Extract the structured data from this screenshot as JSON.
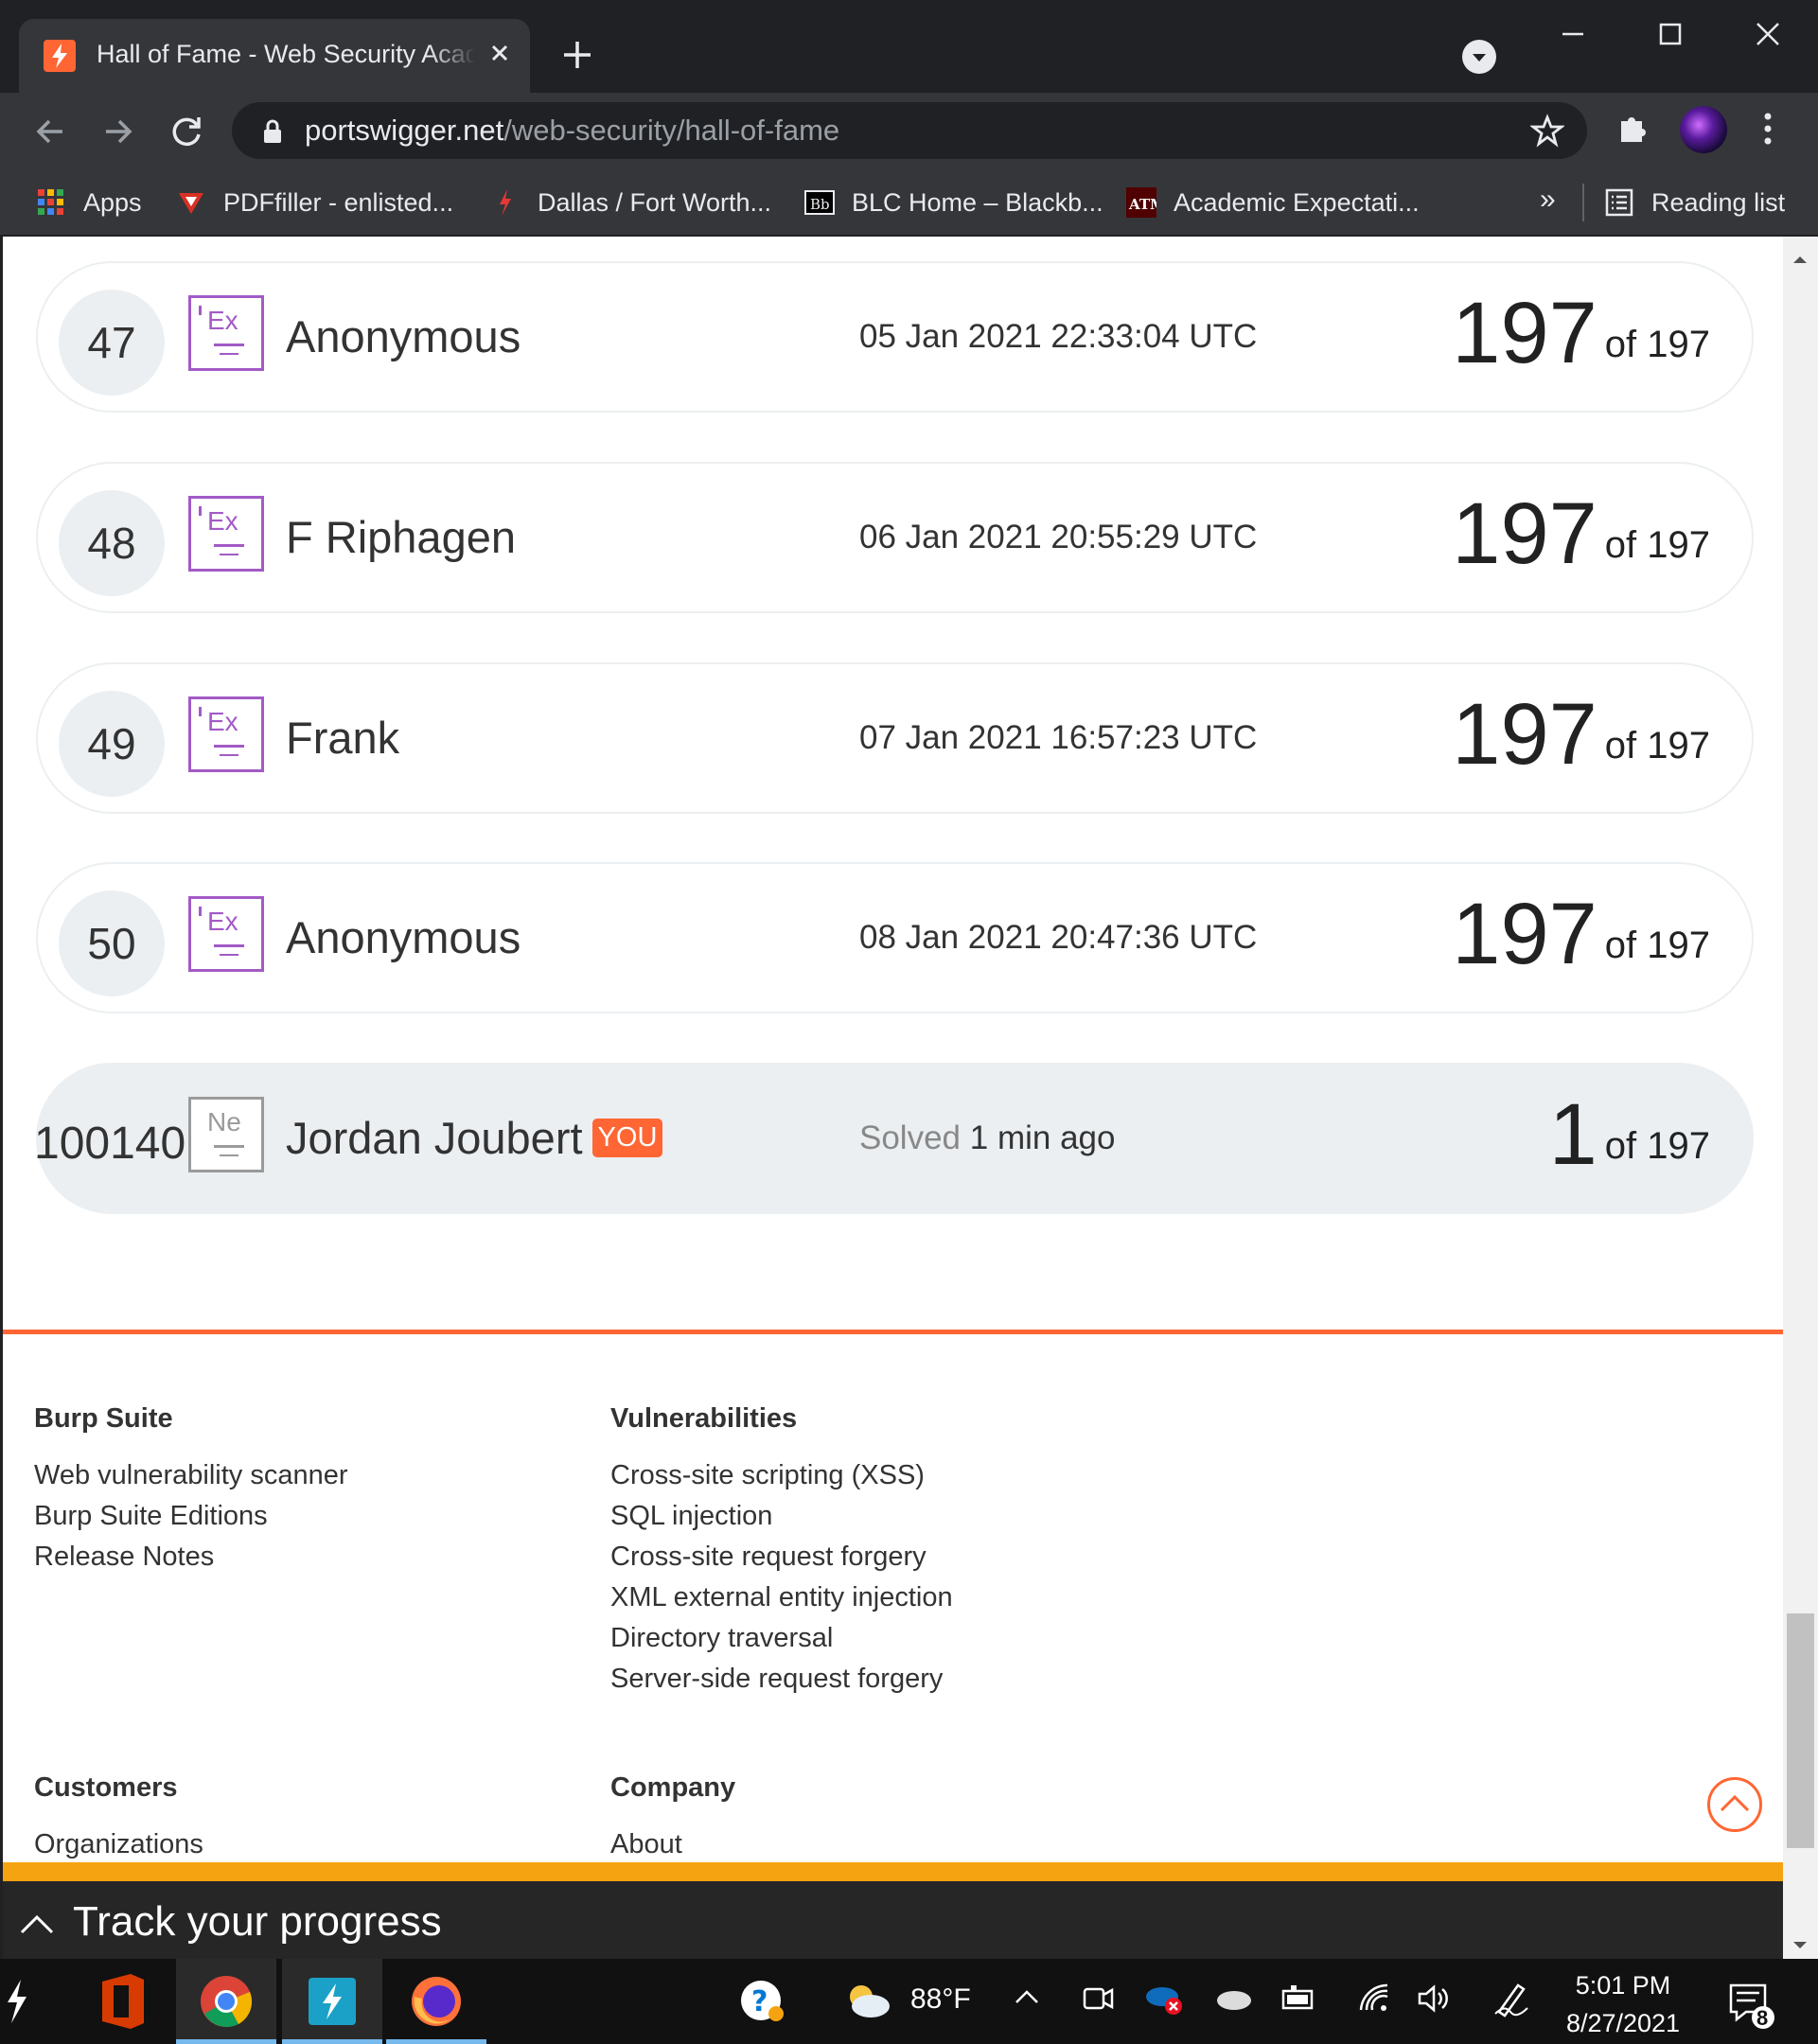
{
  "browser": {
    "tab_title": "Hall of Fame - Web Security Academy",
    "url_host": "portswigger.net",
    "url_path": "/web-security/hall-of-fame",
    "bookmarks": [
      {
        "label": "Apps",
        "icon": "apps-grid-icon"
      },
      {
        "label": "PDFfiller - enlisted...",
        "icon": "pdffiller-icon"
      },
      {
        "label": "Dallas / Fort Worth...",
        "icon": "dallas-bookmark-icon"
      },
      {
        "label": "BLC Home – Blackb...",
        "icon": "blackboard-icon"
      },
      {
        "label": "Academic Expectati...",
        "icon": "tamu-icon"
      }
    ],
    "more_bookmarks": "»",
    "reading_list": "Reading list"
  },
  "leaderboard": {
    "rows": [
      {
        "rank": "47",
        "level": "Ex",
        "name": "Anonymous",
        "time": "05 Jan 2021 22:33:04 UTC",
        "score": "197",
        "total": "of 197"
      },
      {
        "rank": "48",
        "level": "Ex",
        "name": "F Riphagen",
        "time": "06 Jan 2021 20:55:29 UTC",
        "score": "197",
        "total": "of 197"
      },
      {
        "rank": "49",
        "level": "Ex",
        "name": "Frank",
        "time": "07 Jan 2021 16:57:23 UTC",
        "score": "197",
        "total": "of 197"
      },
      {
        "rank": "50",
        "level": "Ex",
        "name": "Anonymous",
        "time": "08 Jan 2021 20:47:36 UTC",
        "score": "197",
        "total": "of 197"
      }
    ],
    "me": {
      "rank": "100140",
      "level": "Ne",
      "name": "Jordan Joubert",
      "badge": "YOU",
      "solved_label": "Solved",
      "solved_time": "1 min ago",
      "score": "1",
      "total": "of 197"
    }
  },
  "footer": {
    "burp": {
      "heading": "Burp Suite",
      "links": [
        "Web vulnerability scanner",
        "Burp Suite Editions",
        "Release Notes"
      ]
    },
    "vulns": {
      "heading": "Vulnerabilities",
      "links": [
        "Cross-site scripting (XSS)",
        "SQL injection",
        "Cross-site request forgery",
        "XML external entity injection",
        "Directory traversal",
        "Server-side request forgery"
      ]
    },
    "customers": {
      "heading": "Customers",
      "links": [
        "Organizations"
      ]
    },
    "company": {
      "heading": "Company",
      "links": [
        "About"
      ]
    }
  },
  "track": {
    "label": "Track your progress"
  },
  "taskbar": {
    "weather": "88°F",
    "time": "5:01 PM",
    "date": "8/27/2021",
    "notifications": "8"
  },
  "colors": {
    "accent": "#ff6633",
    "expert": "#a25bc6",
    "track_bar": "#f5a311"
  }
}
